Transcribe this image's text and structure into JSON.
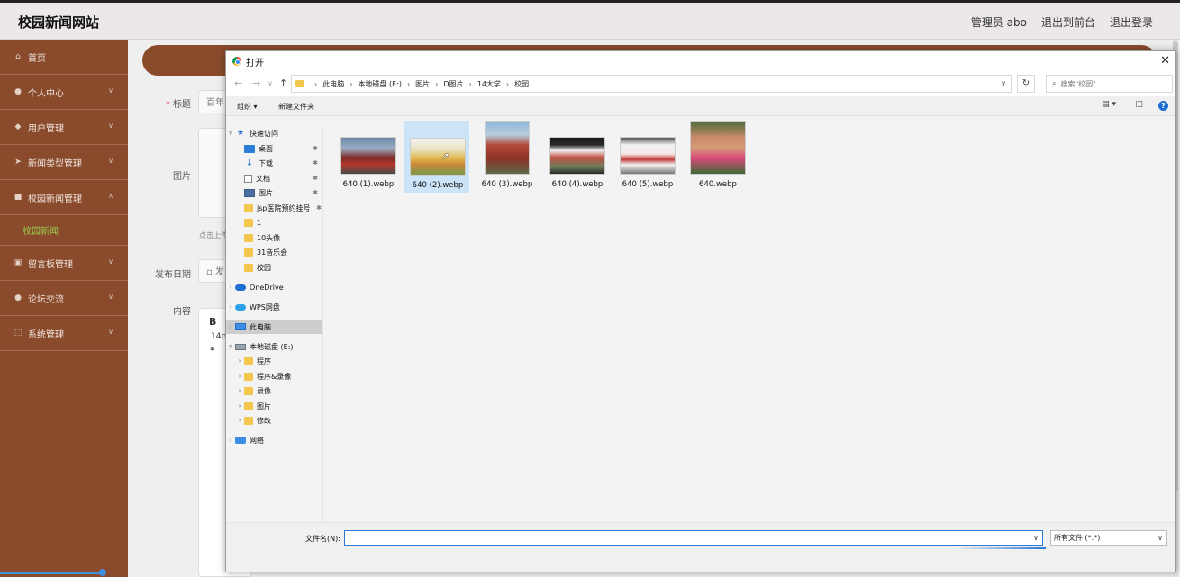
{
  "app": {
    "site_title": "校园新闻网站",
    "user_label": "管理员 abo",
    "frontend_link": "退出到前台",
    "logout_link": "退出登录"
  },
  "sidebar": {
    "items": [
      {
        "label": "首页",
        "icon": "home-icon"
      },
      {
        "label": "个人中心",
        "icon": "user-icon"
      },
      {
        "label": "用户管理",
        "icon": "shield-icon"
      },
      {
        "label": "新闻类型管理",
        "icon": "send-icon"
      },
      {
        "label": "校园新闻管理",
        "icon": "video-icon"
      },
      {
        "label": "留言板管理",
        "icon": "message-icon"
      },
      {
        "label": "论坛交流",
        "icon": "user-icon"
      },
      {
        "label": "系统管理",
        "icon": "settings-icon"
      }
    ],
    "active_sub": "校园新闻"
  },
  "form": {
    "title_label": "标题",
    "title_value": "百年",
    "image_label": "图片",
    "upload_hint": "点击上传",
    "date_label": "发布日期",
    "date_placeholder": "发",
    "content_label": "内容",
    "editor_font_size": "14p"
  },
  "dialog": {
    "title": "打开",
    "path": [
      "此电脑",
      "本地磁盘 (E:)",
      "图片",
      "D图片",
      "14大学",
      "校园"
    ],
    "search_placeholder": "搜索\"校园\"",
    "organize_label": "组织 ▾",
    "new_folder_label": "新建文件夹",
    "tree": {
      "quick_access": "快速访问",
      "desktop": "桌面",
      "downloads": "下载",
      "documents": "文档",
      "pictures": "图片",
      "folder_jsp": "jsp医院预约挂号",
      "folder_1": "1",
      "folder_10": "10头像",
      "folder_31": "31音乐会",
      "folder_campus": "校园",
      "onedrive": "OneDrive",
      "wps": "WPS网盘",
      "this_pc": "此电脑",
      "drive_e": "本地磁盘 (E:)",
      "folder_program": "程序",
      "folder_program_rec": "程序&录像",
      "folder_record": "录像",
      "folder_pictures": "图片",
      "folder_modify": "修改",
      "network": "网络"
    },
    "files": [
      {
        "name": "640 (1).webp"
      },
      {
        "name": "640 (2).webp"
      },
      {
        "name": "640 (3).webp"
      },
      {
        "name": "640 (4).webp"
      },
      {
        "name": "640 (5).webp"
      },
      {
        "name": "640.webp"
      }
    ],
    "filename_label": "文件名(N):",
    "filename_value": "",
    "filetype_value": "所有文件 (*.*)"
  },
  "colors": {
    "sidebar_bg": "#8a4b2c",
    "active_sub_text": "#9bd04b",
    "selection_blue": "#cce4f7",
    "accent_blue": "#2b79d4"
  }
}
